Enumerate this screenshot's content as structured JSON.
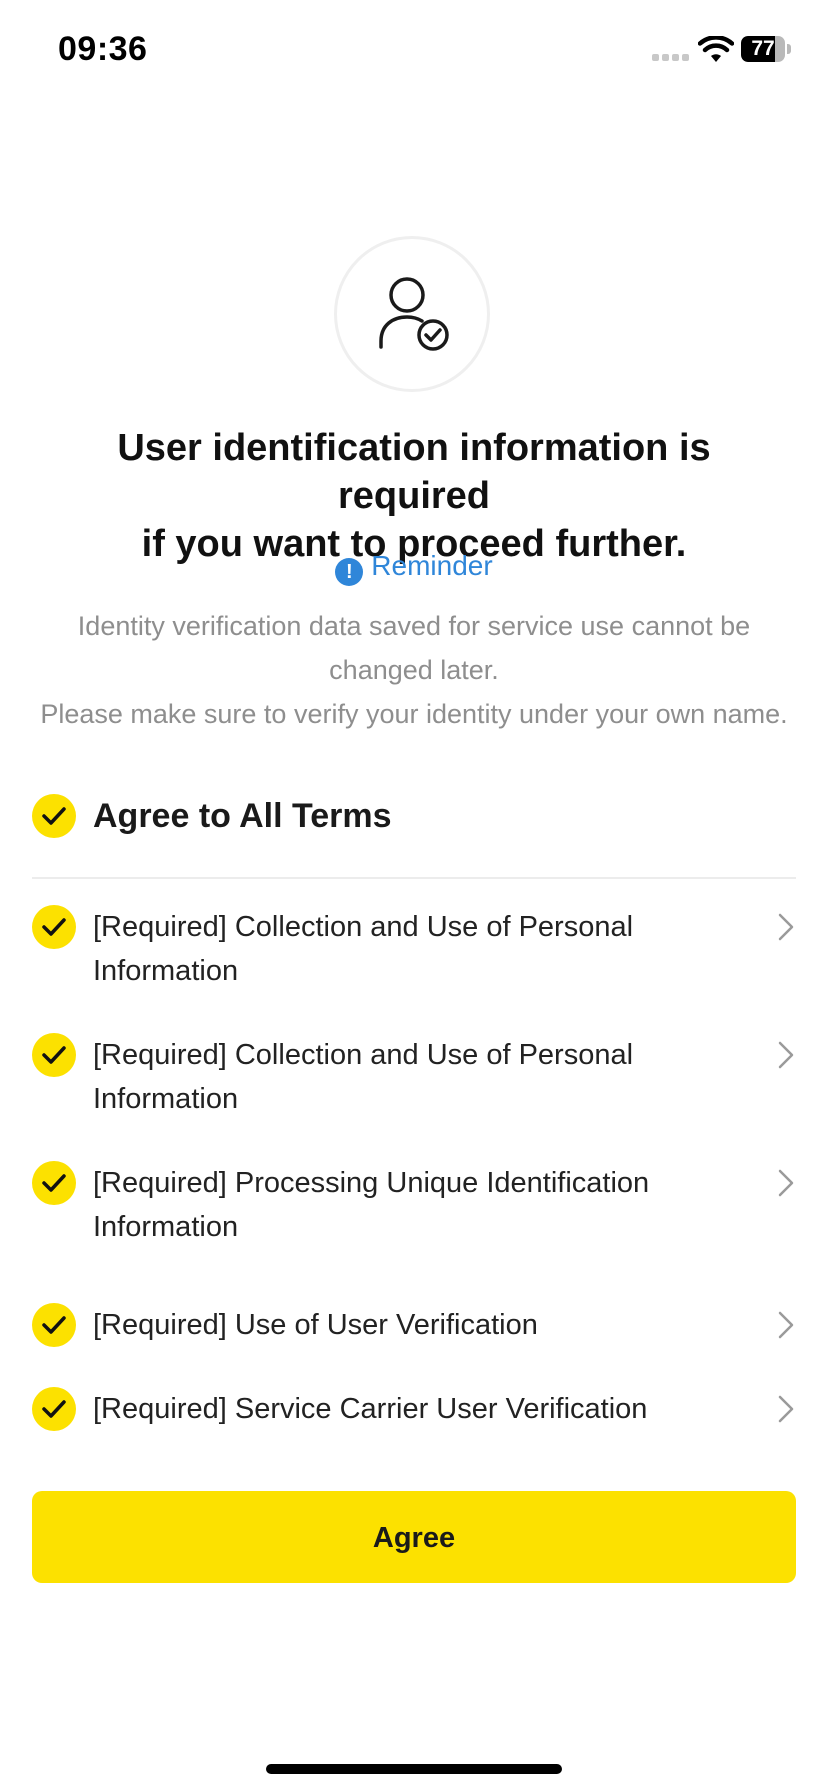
{
  "status_bar": {
    "time": "09:36",
    "battery_level": "77",
    "battery_fraction": 0.77,
    "icons": [
      "cellular-signal-icon",
      "wifi-icon",
      "battery-icon"
    ]
  },
  "header": {
    "icon": "user-verified-icon",
    "title_line1": "User identification information is required",
    "title_line2": "if you want to proceed further."
  },
  "reminder": {
    "icon": "exclamation-icon",
    "icon_glyph": "!",
    "label": "Reminder",
    "color": "#2F86D9"
  },
  "notice": {
    "line1": "Identity verification data saved for service use cannot be",
    "line2": "changed later.",
    "line3": "Please make sure to verify your identity under your own name."
  },
  "agree_all": {
    "label": "Agree to All Terms",
    "checked": true
  },
  "terms": [
    {
      "label": "[Required] Collection and Use of Personal Information",
      "checked": true
    },
    {
      "label": "[Required] Collection and Use of Personal Information",
      "checked": true
    },
    {
      "label": "[Required] Processing Unique Identification Information",
      "checked": true
    },
    {
      "label": "[Required] Use of User Verification",
      "checked": true
    },
    {
      "label": "[Required] Service Carrier User Verification",
      "checked": true
    }
  ],
  "agree_button": {
    "label": "Agree",
    "color": "#FCE100"
  },
  "colors": {
    "accent": "#FCE100",
    "link": "#2F86D9",
    "muted_text": "#8E8E8E"
  }
}
